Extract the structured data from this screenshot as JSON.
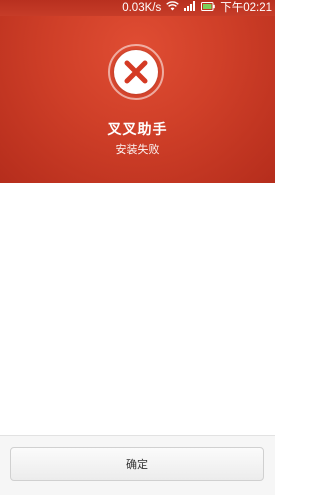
{
  "status_bar": {
    "net_speed": "0.03K/s",
    "time": "下午02:21",
    "icons": [
      "wifi-icon",
      "signal-icon",
      "battery-icon"
    ]
  },
  "header": {
    "status_icon": "close-x-icon",
    "app_name": "叉叉助手",
    "message": "安装失败",
    "colors": {
      "background": "#cf3f28",
      "icon": "#d43a24"
    }
  },
  "footer": {
    "confirm_label": "确定"
  }
}
